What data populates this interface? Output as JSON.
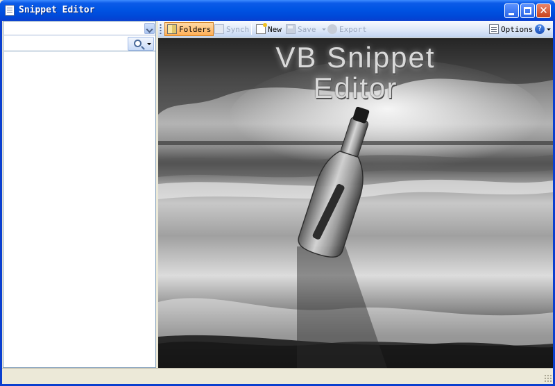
{
  "window": {
    "title": "Snippet Editor"
  },
  "left_panel": {
    "combo_value": "",
    "search_value": "",
    "search_placeholder": ""
  },
  "toolbar": {
    "folders_label": "Folders",
    "synch_label": "Synch",
    "new_label": "New",
    "save_label": "Save",
    "export_label": "Export",
    "options_label": "Options",
    "help_glyph": "?"
  },
  "splash": {
    "title_line1": "VB Snippet",
    "title_line2": "Editor"
  },
  "status": {
    "text": ""
  },
  "icons": {
    "app": "document-icon",
    "folders": "folders-icon",
    "synch": "synch-icon",
    "new": "new-document-icon",
    "save": "save-icon",
    "export": "export-icon",
    "options": "options-icon",
    "help": "help-icon",
    "search": "search-icon"
  },
  "colors": {
    "titlebar": "#0054e3",
    "active_button": "#ffaf56",
    "toolbar": "#dce7f8",
    "close_button": "#c8421c"
  }
}
